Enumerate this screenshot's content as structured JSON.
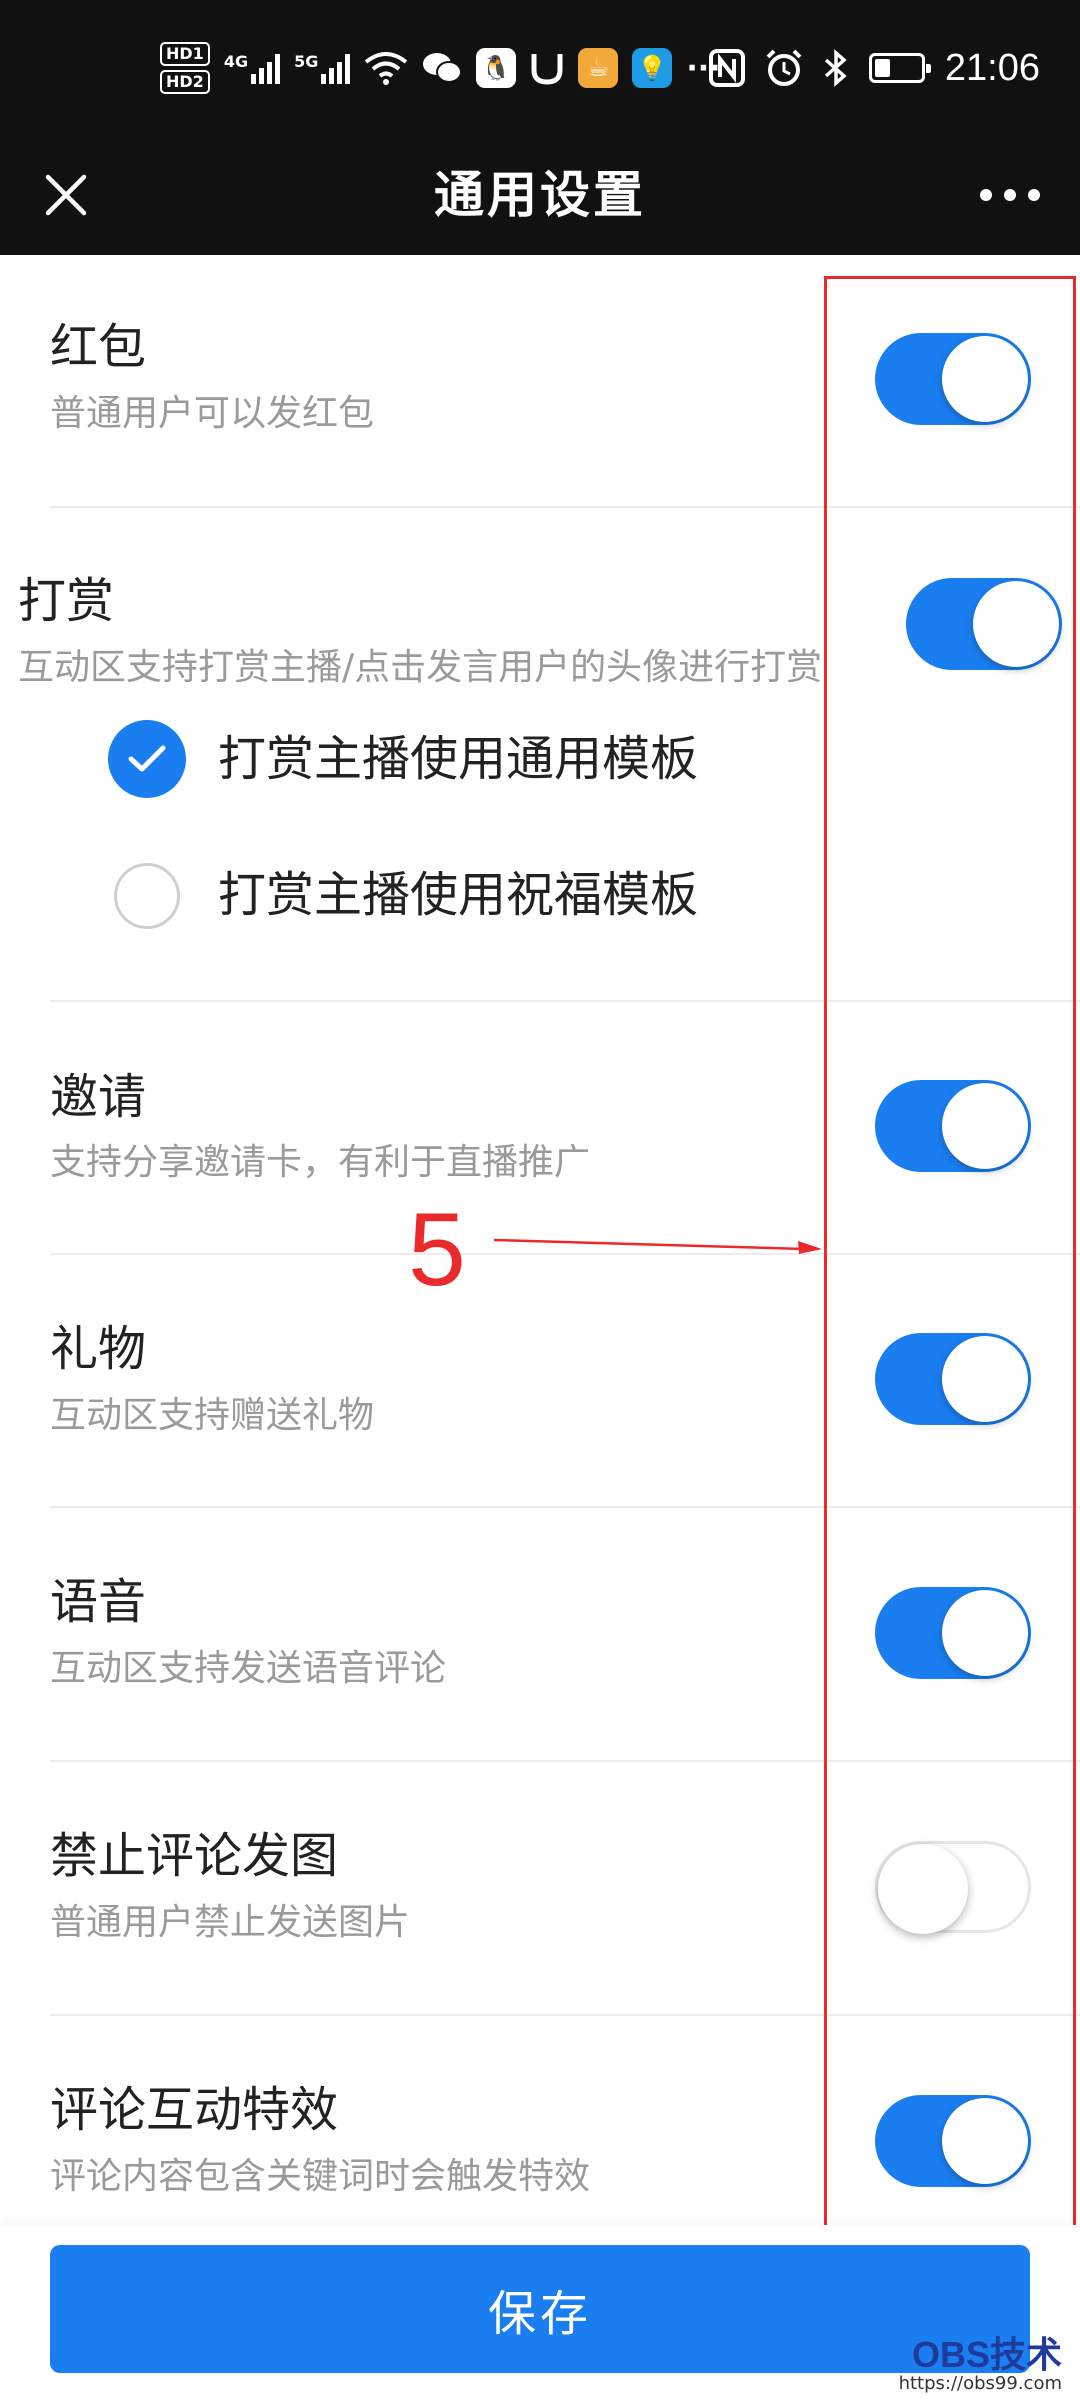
{
  "status_bar": {
    "hd1": "HD1",
    "hd2": "HD2",
    "net1": "4G",
    "net2": "5G",
    "more": "···",
    "time": "21:06"
  },
  "title_bar": {
    "title": "通用设置"
  },
  "settings": [
    {
      "title": "红包",
      "desc": "普通用户可以发红包",
      "enabled": true
    },
    {
      "title": "打赏",
      "desc": "互动区支持打赏主播/点击发言用户的头像进行打赏",
      "enabled": true
    },
    {
      "title": "邀请",
      "desc": "支持分享邀请卡，有利于直播推广",
      "enabled": true
    },
    {
      "title": "礼物",
      "desc": "互动区支持赠送礼物",
      "enabled": true
    },
    {
      "title": "语音",
      "desc": "互动区支持发送语音评论",
      "enabled": true
    },
    {
      "title": "禁止评论发图",
      "desc": "普通用户禁止发送图片",
      "enabled": false
    },
    {
      "title": "评论互动特效",
      "desc": "评论内容包含关键词时会触发特效",
      "enabled": true
    }
  ],
  "reward_templates": {
    "options": [
      "打赏主播使用通用模板",
      "打赏主播使用祝福模板"
    ],
    "selected": "打赏主播使用通用模板"
  },
  "annotation": {
    "number": "5",
    "color": "#ea2a2a"
  },
  "footer": {
    "save_label": "保存"
  },
  "watermark": {
    "main": "OBS技术",
    "sub": "https://obs99.com"
  },
  "colors": {
    "accent": "#1a7ef0",
    "topbar": "#111111"
  }
}
